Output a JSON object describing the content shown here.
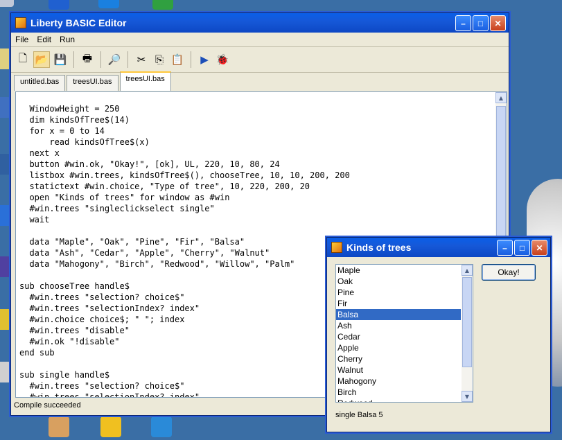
{
  "main_window": {
    "title": "Liberty BASIC Editor",
    "menu": [
      "File",
      "Edit",
      "Run"
    ],
    "toolbar_icons": [
      "new-icon",
      "open-icon",
      "save-icon",
      "print-icon",
      "find-icon",
      "cut-icon",
      "copy-icon",
      "paste-icon",
      "run-icon",
      "debug-icon"
    ],
    "tabs": [
      "untitled.bas",
      "treesUI.bas",
      "treesUI.bas"
    ],
    "active_tab": 2,
    "code": "  WindowHeight = 250\n  dim kindsOfTree$(14)\n  for x = 0 to 14\n      read kindsOfTree$(x)\n  next x\n  button #win.ok, \"Okay!\", [ok], UL, 220, 10, 80, 24\n  listbox #win.trees, kindsOfTree$(), chooseTree, 10, 10, 200, 200\n  statictext #win.choice, \"Type of tree\", 10, 220, 200, 20\n  open \"Kinds of trees\" for window as #win\n  #win.trees \"singleclickselect single\"\n  wait\n\n  data \"Maple\", \"Oak\", \"Pine\", \"Fir\", \"Balsa\"\n  data \"Ash\", \"Cedar\", \"Apple\", \"Cherry\", \"Walnut\"\n  data \"Mahogony\", \"Birch\", \"Redwood\", \"Willow\", \"Palm\"\n\nsub chooseTree handle$\n  #win.trees \"selection? choice$\"\n  #win.trees \"selectionIndex? index\"\n  #win.choice choice$; \" \"; index\n  #win.trees \"disable\"\n  #win.ok \"!disable\"\nend sub\n\nsub single handle$\n  #win.trees \"selection? choice$\"\n  #win.trees \"selectionIndex? index\"",
    "status": "Compile succeeded"
  },
  "popup_window": {
    "title": "Kinds of trees",
    "items": [
      "Maple",
      "Oak",
      "Pine",
      "Fir",
      "Balsa",
      "Ash",
      "Cedar",
      "Apple",
      "Cherry",
      "Walnut",
      "Mahogony",
      "Birch",
      "Redwood"
    ],
    "selected_index": 4,
    "ok_label": "Okay!",
    "choice_text": "single Balsa 5"
  },
  "colors": {
    "desktop": "#3a6ea5",
    "title_bar": "#0d48c4",
    "selection": "#316ac5"
  }
}
